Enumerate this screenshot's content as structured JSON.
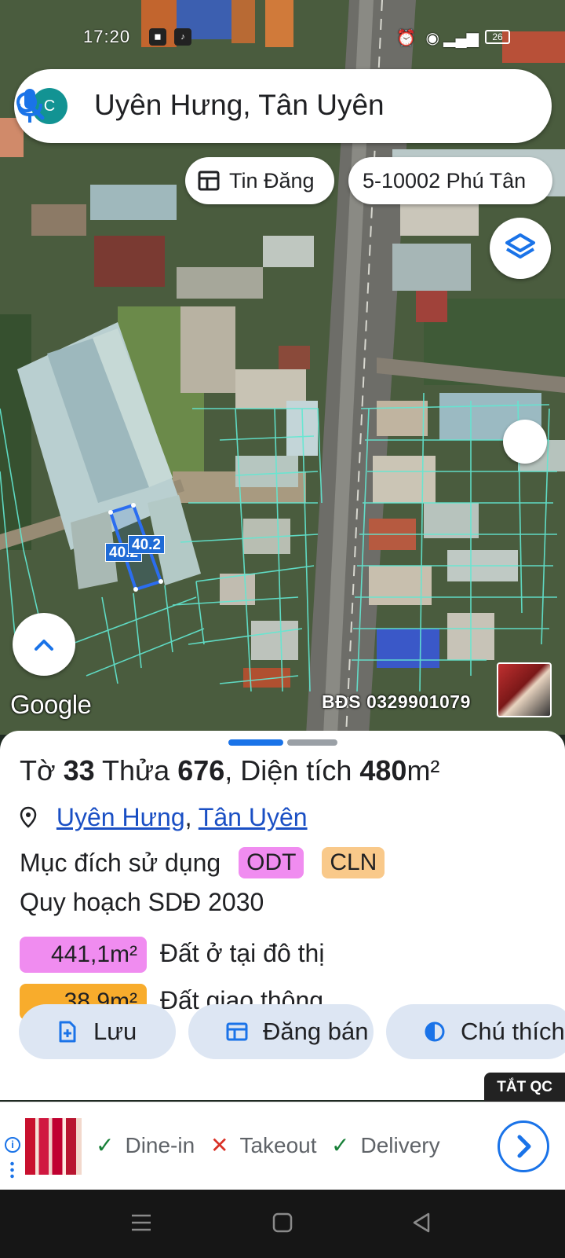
{
  "status_bar": {
    "time": "17:20",
    "battery": "26"
  },
  "search": {
    "avatar_letter": "C",
    "query": "Uyên Hưng, Tân Uyên"
  },
  "chips": {
    "listings": "Tin Đăng",
    "parcel": "5-10002 Phú Tân"
  },
  "map": {
    "measure_labels": [
      "40.2",
      "40.2"
    ],
    "attribution": "Google",
    "watermark": "BĐS 0329901079"
  },
  "sheet": {
    "title_prefix": "Tờ",
    "sheet_no": "33",
    "parcel_word": "Thửa",
    "parcel_no": "676",
    "area_word": ", Diện tích",
    "area": "480",
    "area_unit": "m²",
    "location": {
      "ward": "Uyên Hưng",
      "separator": ",",
      "district": "Tân Uyên"
    },
    "purpose_label": "Mục đích sử dụng",
    "purpose_tags": [
      "ODT",
      "CLN"
    ],
    "plan_label": "Quy hoạch SDĐ 2030",
    "zones": [
      {
        "area": "441,1m²",
        "desc": "Đất ở tại đô thị",
        "color": "#f08cf0"
      },
      {
        "area": "38,9m²",
        "desc": "Đất giao thông",
        "color": "#f8ac2c"
      }
    ],
    "actions": {
      "save": "Lưu",
      "sell": "Đăng bán",
      "legend": "Chú thích"
    }
  },
  "no_ads_label": "TẮT QC",
  "ad": {
    "services": [
      {
        "mark": "✓",
        "label": "Dine-in"
      },
      {
        "mark": "✕",
        "label": "Takeout"
      },
      {
        "mark": "✓",
        "label": "Delivery"
      }
    ]
  },
  "colors": {
    "accent": "#1a73e8",
    "parcel_line": "#62e8d2",
    "avatar": "#129393"
  }
}
